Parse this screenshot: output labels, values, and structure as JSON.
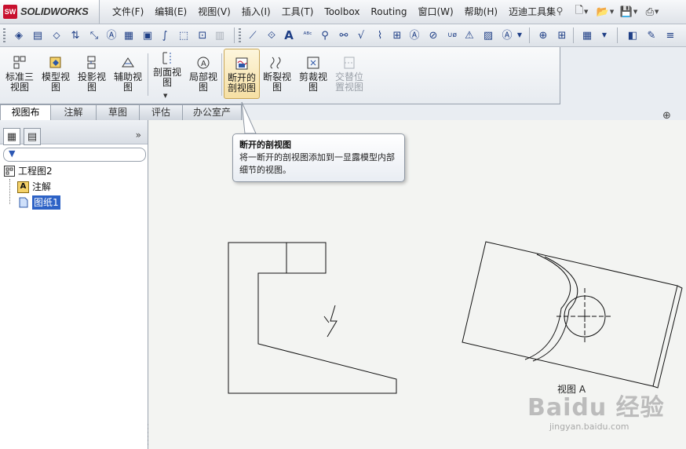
{
  "app": {
    "logo_text": "SOLIDWORKS",
    "logo_mark": "SW"
  },
  "menu": [
    "文件(F)",
    "编辑(E)",
    "视图(V)",
    "插入(I)",
    "工具(T)",
    "Toolbox",
    "Routing",
    "窗口(W)",
    "帮助(H)",
    "迈迪工具集"
  ],
  "command_manager": {
    "buttons": [
      {
        "label": "标准三视图"
      },
      {
        "label": "模型视图"
      },
      {
        "label": "投影视图"
      },
      {
        "label": "辅助视图"
      },
      {
        "label": "剖面视图"
      },
      {
        "label": "局部视图"
      },
      {
        "label": "断开的剖视图"
      },
      {
        "label": "断裂视图"
      },
      {
        "label": "剪裁视图"
      },
      {
        "label": "交替位置视图"
      }
    ]
  },
  "tabs": [
    "视图布局",
    "注解",
    "草图",
    "评估",
    "办公室产品"
  ],
  "feature_tree": {
    "root": "工程图2",
    "children": [
      "注解",
      "图纸1"
    ]
  },
  "tooltip": {
    "title": "断开的剖视图",
    "body": "将一断开的剖视图添加到一显露模型内部细节的视图。"
  },
  "drawing": {
    "view_label": "视图 A"
  },
  "watermark": {
    "main": "Baidu 经验",
    "sub": "jingyan.baidu.com"
  },
  "colors": {
    "accent": "#2d62c6",
    "active_button": "#f6dfa3",
    "brand": "#c8102e"
  }
}
